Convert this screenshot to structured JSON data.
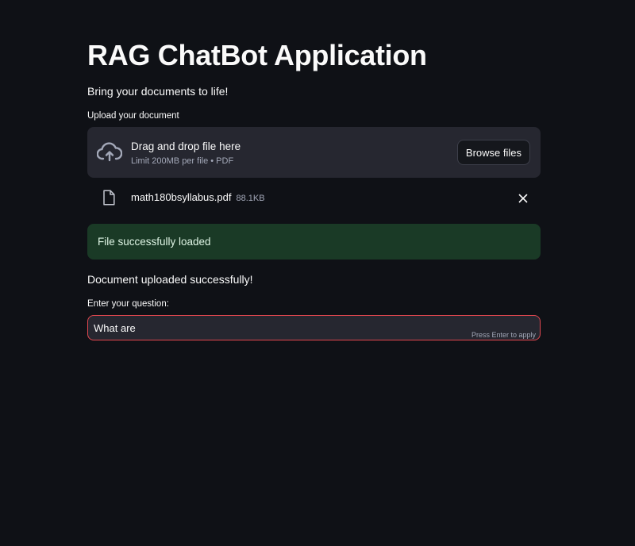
{
  "page": {
    "title": "RAG ChatBot Application",
    "subtitle": "Bring your documents to life!"
  },
  "uploader": {
    "label": "Upload your document",
    "drop_text": "Drag and drop file here",
    "limit_text": "Limit 200MB per file • PDF",
    "browse_label": "Browse files",
    "icon": "cloud-upload-icon"
  },
  "uploaded_file": {
    "name": "math180bsyllabus.pdf",
    "size": "88.1KB",
    "icon": "file-icon",
    "remove_icon": "close-icon"
  },
  "alerts": {
    "success": "File successfully loaded",
    "uploaded_message": "Document uploaded successfully!"
  },
  "question": {
    "label": "Enter your question:",
    "value": "What are",
    "hint": "Press Enter to apply"
  },
  "colors": {
    "background": "#0f1116",
    "panel": "#262730",
    "success_bg": "#1a3a26",
    "input_border": "#e0474f"
  }
}
